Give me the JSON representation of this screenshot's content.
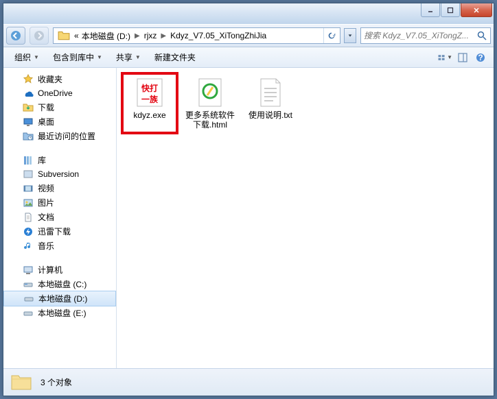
{
  "breadcrumbs": {
    "prefix": "«",
    "items": [
      "本地磁盘 (D:)",
      "rjxz",
      "Kdyz_V7.05_XiTongZhiJia"
    ]
  },
  "search": {
    "placeholder": "搜索 Kdyz_V7.05_XiTongZ..."
  },
  "toolbar": {
    "organize": "组织",
    "include": "包含到库中",
    "share": "共享",
    "newfolder": "新建文件夹"
  },
  "sidebar": {
    "favorites": {
      "label": "收藏夹",
      "items": [
        {
          "name": "OneDrive",
          "icon": "onedrive"
        },
        {
          "name": "下载",
          "icon": "download"
        },
        {
          "name": "桌面",
          "icon": "desktop"
        },
        {
          "name": "最近访问的位置",
          "icon": "recent"
        }
      ]
    },
    "libraries": {
      "label": "库",
      "items": [
        {
          "name": "Subversion",
          "icon": "subversion"
        },
        {
          "name": "视频",
          "icon": "video"
        },
        {
          "name": "图片",
          "icon": "picture"
        },
        {
          "name": "文档",
          "icon": "document"
        },
        {
          "name": "迅雷下载",
          "icon": "thunder"
        },
        {
          "name": "音乐",
          "icon": "music"
        }
      ]
    },
    "computer": {
      "label": "计算机",
      "items": [
        {
          "name": "本地磁盘 (C:)",
          "icon": "drive-c"
        },
        {
          "name": "本地磁盘 (D:)",
          "icon": "drive",
          "selected": true
        },
        {
          "name": "本地磁盘 (E:)",
          "icon": "drive"
        }
      ]
    }
  },
  "files": [
    {
      "name": "kdyz.exe",
      "icon": "kdyz",
      "highlighted": true
    },
    {
      "name": "更多系统软件下载.html",
      "icon": "html"
    },
    {
      "name": "使用说明.txt",
      "icon": "txt"
    }
  ],
  "status": {
    "count": "3 个对象"
  }
}
